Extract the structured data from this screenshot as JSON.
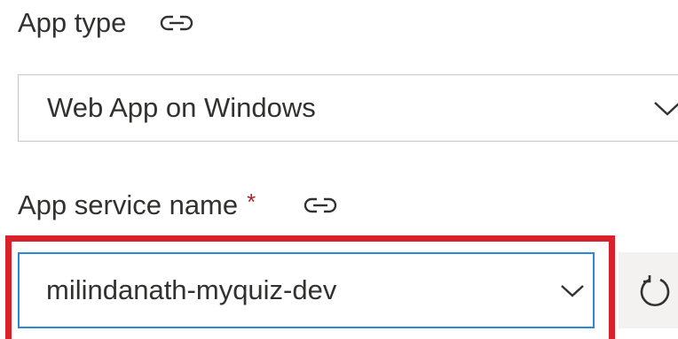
{
  "app_type": {
    "label": "App type",
    "link_icon": "link-icon",
    "selected_value": "Web App on Windows",
    "dropdown_icon": "chevron-down-icon"
  },
  "app_service_name": {
    "label": "App service name",
    "required_marker": "*",
    "link_icon": "link-icon",
    "selected_value": "milindanath-myquiz-dev",
    "dropdown_icon": "chevron-down-icon",
    "refresh_icon": "refresh-icon"
  },
  "colors": {
    "highlight": "#d9202b",
    "focus_border": "#2b88d8",
    "required": "#a4262c"
  }
}
